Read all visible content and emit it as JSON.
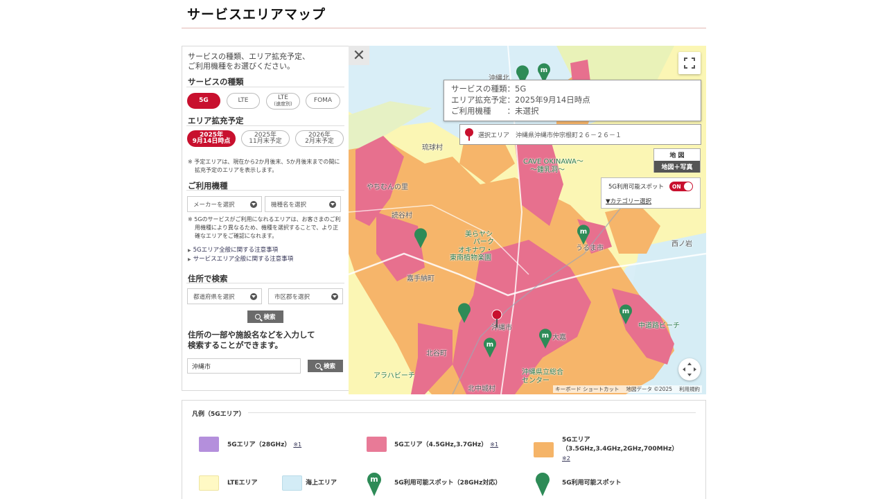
{
  "page": {
    "title": "サービスエリアマップ"
  },
  "panel": {
    "intro_line1": "サービスの種類、エリア拡充予定、",
    "intro_line2": "ご利用機種をお選びください。",
    "service_title": "サービスの種類",
    "services": [
      {
        "label": "5G"
      },
      {
        "label": "LTE"
      },
      {
        "label": "LTE",
        "sub": "(速度別)"
      },
      {
        "label": "FOMA"
      }
    ],
    "expansion_title": "エリア拡充予定",
    "expansion": [
      {
        "line1": "2025年",
        "line2": "9月14日時点"
      },
      {
        "line1": "2025年",
        "line2": "11月末予定"
      },
      {
        "line1": "2026年",
        "line2": "2月末予定"
      }
    ],
    "expansion_note_1": "※ 予定エリアは、現在から2か月後末、5か月後末までの間に",
    "expansion_note_2": "拡充予定のエリアを表示します。",
    "device_title": "ご利用機種",
    "maker_placeholder": "メーカーを選択",
    "model_placeholder": "機種名を選択",
    "device_note_1": "※ 5Gのサービスがご利用になれるエリアは、お客さまのご利",
    "device_note_2": "用機種により異なるため、機種を選択することで、より正",
    "device_note_3": "確なエリアをご確認になれます。",
    "link_5g": "5Gエリア全般に関する注意事項",
    "link_service": "サービスエリア全般に関する注意事項",
    "address_title": "住所で検索",
    "pref_placeholder": "都道府県を選択",
    "city_placeholder": "市区郡を選択",
    "search_label": "検索",
    "freeword_line1": "住所の一部や施設名などを入力して",
    "freeword_line2": "検索することができます。",
    "freeword_value": "沖縄市",
    "search_label2": "検索"
  },
  "map": {
    "info_line1": "サービスの種類：5G",
    "info_line2": "エリア拡充予定：2025年9月14日時点",
    "info_line3": "ご利用機種　　：未選択",
    "selected_area": "選択エリア　沖縄県沖縄市仲宗根町２６－２６－１",
    "maptype_map": "地 図",
    "maptype_photo": "地図＋写真",
    "spot_label": "5G利用可能スポット",
    "toggle_label": "ON",
    "category_link": "▼カテゴリー選択",
    "attrib_shortcuts": "キーボード ショートカット",
    "attrib_data": "地図データ ©2025",
    "attrib_terms": "利用規約",
    "labels": {
      "okinawa_top": "沖縄北",
      "ryukyu": "琉球村",
      "yachimun": "やちむんの里",
      "yomitan": "読谷村",
      "churaumi": "美らヤシ",
      "park": "パーク",
      "okinawa_botanical": "オキナワ・",
      "tonan": "東南植物楽園",
      "kadena": "嘉手納町",
      "okinawa_city": "沖縄市",
      "uruma": "うるま市",
      "nishinoiwa": "西ノ岩",
      "chatan": "北谷町",
      "kitanakagusuku": "北中城村",
      "araha": "アラハビーチ",
      "nakagusuku_beach": "中道路ビーチ",
      "cave": "CAVE OKINAWA～",
      "gyokusendo": "～鍾乳洞～",
      "hospital1": "沖縄県立総合",
      "hospital2": "センター",
      "kadena2": "大嘉"
    }
  },
  "legend": {
    "title": "凡例（5Gエリア）",
    "note1": "※1",
    "note2": "※2",
    "item_28ghz": "5Gエリア（28GHz）",
    "item_45ghz": "5Gエリア（4.5GHz,3.7GHz）",
    "item_35ghz_line1": "5Gエリア",
    "item_35ghz_line2": "（3.5GHz,3.4GHz,2GHz,700MHz）",
    "item_lte": "LTEエリア",
    "item_sea": "海上エリア",
    "item_spot_28": "5G利用可能スポット（28GHz対応）",
    "item_spot": "5G利用可能スポット",
    "colors": {
      "ghz28": "#b48fdc",
      "ghz45": "#e87a97",
      "ghz35": "#f5b468",
      "lte": "#fff9c4",
      "sea": "#d3ecf6",
      "spot": "#2e8b57"
    }
  }
}
